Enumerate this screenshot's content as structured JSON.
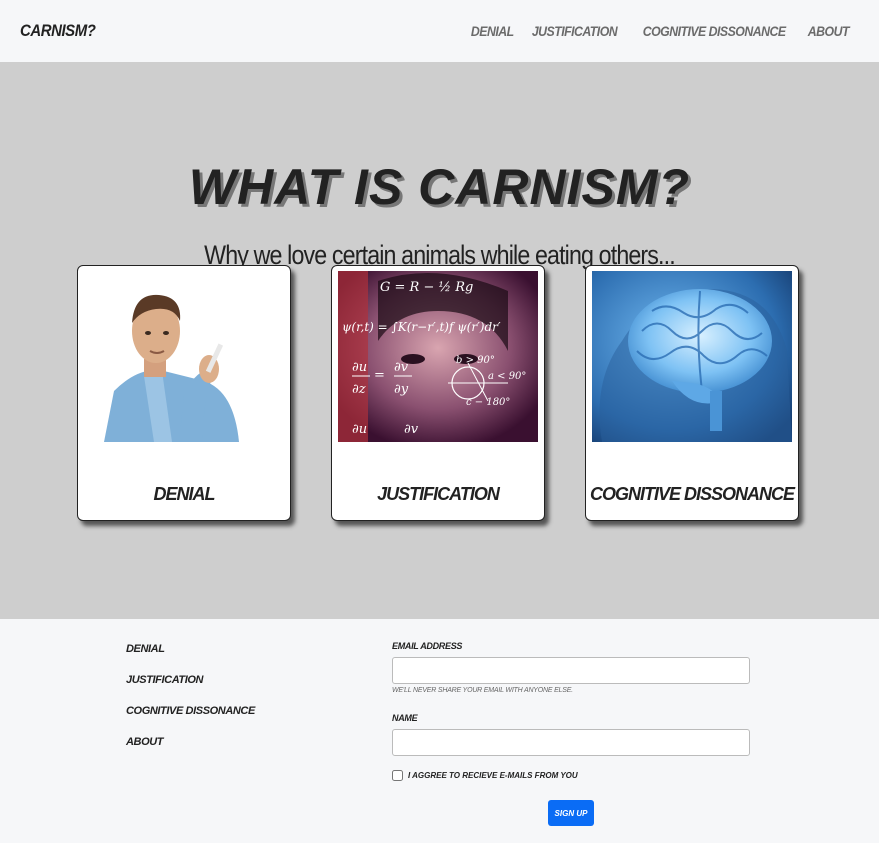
{
  "navbar": {
    "brand": "Carnism?",
    "links": [
      "Denial",
      "Justification",
      "Cognitive Dissonance",
      "About"
    ]
  },
  "hero": {
    "title": "What is Carnism?",
    "subtitle": "Why we love certain animals while eating others..."
  },
  "cards": [
    {
      "label": "Denial",
      "image": "man-gesturing-photo"
    },
    {
      "label": "Justification",
      "image": "woman-with-math-equations-photo"
    },
    {
      "label": "Cognitive Dissonance",
      "image": "glowing-blue-brain-photo"
    }
  ],
  "footer": {
    "links": [
      "Denial",
      "Justification",
      "Cognitive Dissonance",
      "About"
    ],
    "form": {
      "email_label": "Email address",
      "email_value": "",
      "email_help": "We'll never share your email with anyone else.",
      "name_label": "Name",
      "name_value": "",
      "checkbox_label": "I aggree to recieve e-mails from you",
      "submit_label": "Sign up"
    }
  },
  "colors": {
    "hero_bg": "#cecece",
    "nav_bg": "#f6f7f9",
    "button_blue": "#0a6cf5"
  }
}
